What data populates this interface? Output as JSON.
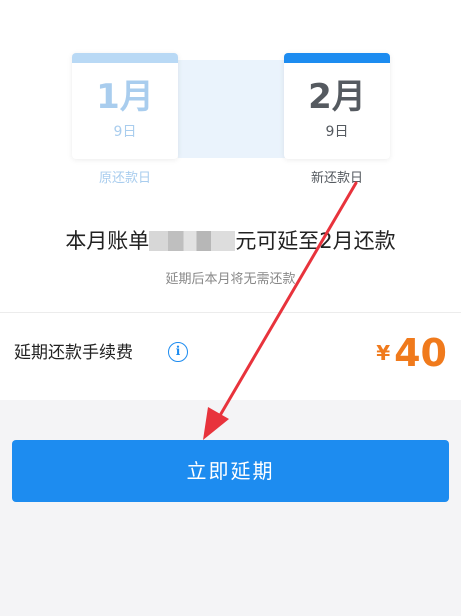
{
  "old_date": {
    "month": "1月",
    "day": "9日",
    "caption": "原还款日"
  },
  "new_date": {
    "month": "2月",
    "day": "9日",
    "caption": "新还款日"
  },
  "headline": {
    "prefix": "本月账单",
    "suffix": "元可延至2月还款"
  },
  "subline": "延期后本月将无需还款",
  "fee": {
    "label": "延期还款手续费",
    "info_icon": "info-circle-icon",
    "currency": "¥",
    "amount": "40"
  },
  "primary_button": {
    "label": "立即延期"
  },
  "annotation": {
    "icon": "red-arrow-icon",
    "color": "#e8333c"
  },
  "colors": {
    "accent": "#1d8cf0",
    "accent_light": "#b9d9f5",
    "fee_orange": "#f07a1c",
    "background": "#f4f4f6"
  }
}
